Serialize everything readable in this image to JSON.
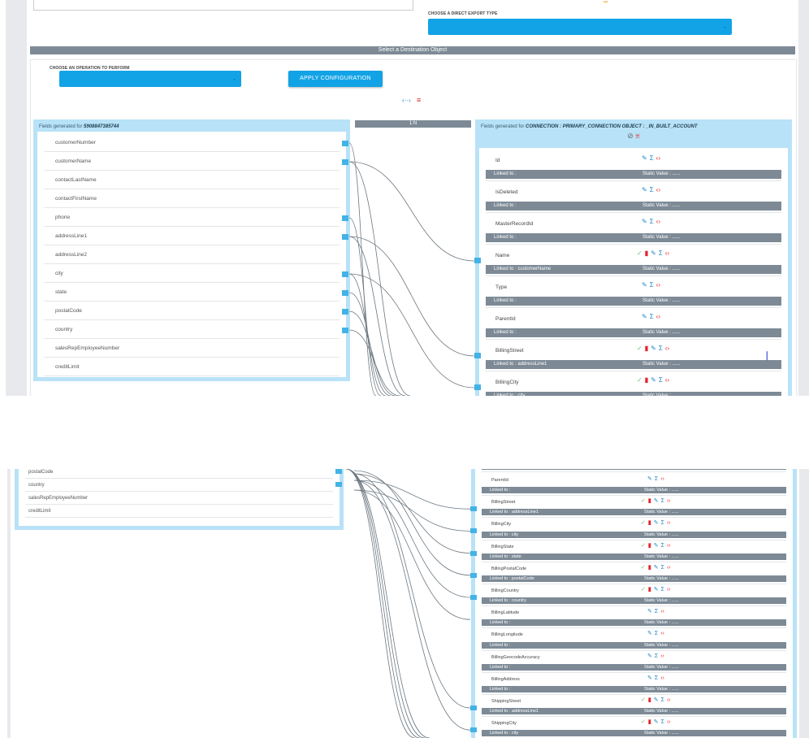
{
  "export": {
    "label": "CHOOSE A DIRECT EXPORT TYPE",
    "selected": ""
  },
  "destination_bar": "Select a Destination Object",
  "operation": {
    "label": "CHOOSE AN OPERATION TO PERFORM",
    "selected": ""
  },
  "apply_button": "APPLY CONFIGURATION",
  "toolbar_icons": [
    "code-toggle-icon",
    "filter-lines-icon"
  ],
  "ratio": "1:N",
  "source": {
    "title_prefix": "Fields generated for ",
    "title_name": "5908847385744",
    "fields": [
      "customerNumber",
      "customerName",
      "contactLastName",
      "contactFirstName",
      "phone",
      "addressLine1",
      "addressLine2",
      "city",
      "state",
      "postalCode",
      "country",
      "salesRepEmployeeNumber",
      "creditLimit"
    ],
    "fields_lower": [
      "postalCode",
      "country",
      "salesRepEmployeeNumber",
      "creditLimit"
    ]
  },
  "destination": {
    "title_prefix": "Fields generated for ",
    "title_name": "CONNECTION : PRIMARY_CONNECTION OBJECT : _IN_BUILT_ACCOUNT",
    "static_label": "Static Value : ......",
    "fields_top": [
      {
        "name": "Id",
        "linked": "Linked to :",
        "mapped": false
      },
      {
        "name": "IsDeleted",
        "linked": "Linked to :",
        "mapped": false
      },
      {
        "name": "MasterRecordId",
        "linked": "Linked to :",
        "mapped": false
      },
      {
        "name": "Name",
        "linked": "Linked to : customerName",
        "mapped": true
      },
      {
        "name": "Type",
        "linked": "Linked to :",
        "mapped": false
      },
      {
        "name": "ParentId",
        "linked": "Linked to :",
        "mapped": false
      },
      {
        "name": "BillingStreet",
        "linked": "Linked to : addressLine1",
        "mapped": true
      },
      {
        "name": "BillingCity",
        "linked": "Linked to : city",
        "mapped": true
      }
    ],
    "fields_lower": [
      {
        "name": "ParentId",
        "linked": "Linked to :",
        "mapped": false
      },
      {
        "name": "BillingStreet",
        "linked": "Linked to : addressLine1",
        "mapped": true
      },
      {
        "name": "BillingCity",
        "linked": "Linked to : city",
        "mapped": true
      },
      {
        "name": "BillingState",
        "linked": "Linked to : state",
        "mapped": true
      },
      {
        "name": "BillingPostalCode",
        "linked": "Linked to : postalCode",
        "mapped": true
      },
      {
        "name": "BillingCountry",
        "linked": "Linked to : country",
        "mapped": true
      },
      {
        "name": "BillingLatitude",
        "linked": "Linked to :",
        "mapped": false
      },
      {
        "name": "BillingLongitude",
        "linked": "Linked to :",
        "mapped": false
      },
      {
        "name": "BillingGeocodeAccuracy",
        "linked": "Linked to :",
        "mapped": false
      },
      {
        "name": "BillingAddress",
        "linked": "Linked to :",
        "mapped": false
      },
      {
        "name": "ShippingStreet",
        "linked": "Linked to : addressLine1",
        "mapped": true
      },
      {
        "name": "ShippingCity",
        "linked": "Linked to : city",
        "mapped": true
      }
    ]
  },
  "icon_names": {
    "check": "check-icon",
    "delete": "delete-icon",
    "edit": "pencil-icon",
    "sum": "sigma-icon",
    "code": "code-icon"
  },
  "colors": {
    "accent": "#12a3e6",
    "bar": "#7d8a96",
    "panel_border": "#b8e2f7",
    "danger": "#e4252a",
    "ok": "#6fc06f"
  }
}
